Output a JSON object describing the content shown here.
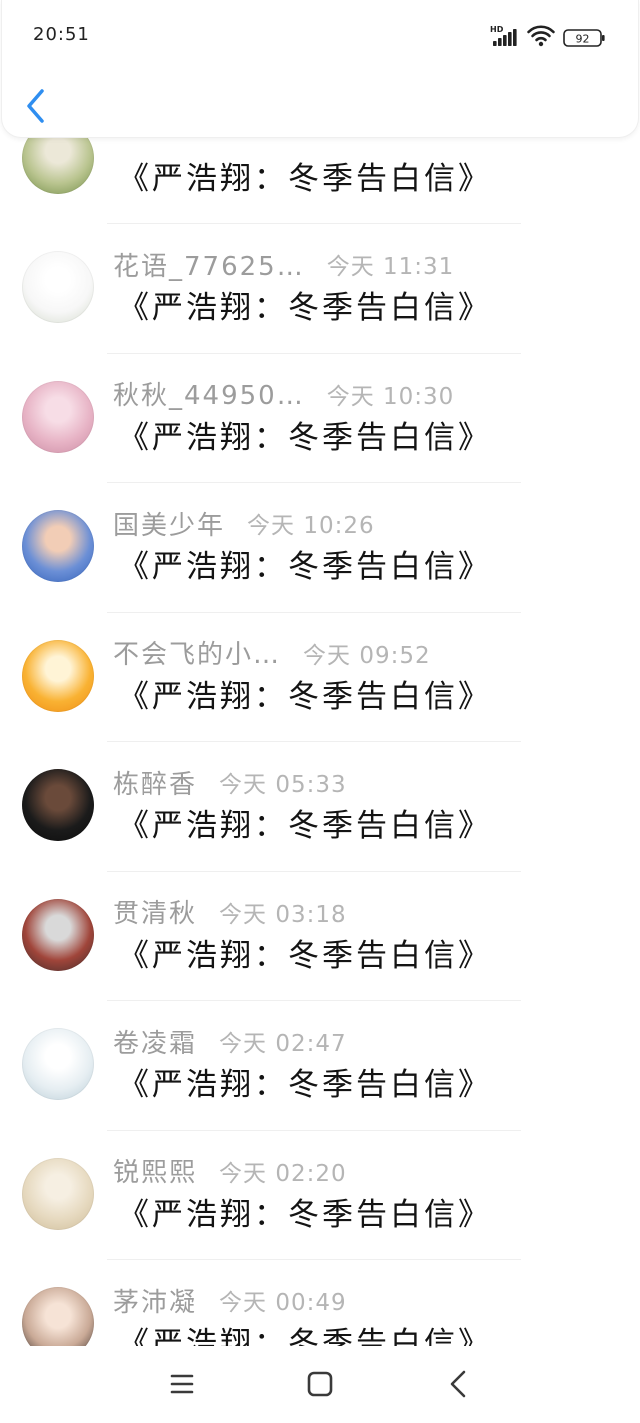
{
  "status_bar": {
    "time": "20:51",
    "network_badge": "HD",
    "battery_level": "92",
    "icons": [
      "signal-icon",
      "wifi-icon",
      "battery-icon"
    ]
  },
  "header": {
    "back_icon": "chevron-left-icon",
    "accent_color": "#2f8ef0"
  },
  "messages": [
    {
      "name": "",
      "time": "",
      "text": "《严浩翔：冬季告白信》",
      "avatar_colors": [
        "#ece8d8",
        "#b9c48f",
        "#6e8a43"
      ]
    },
    {
      "name": "花语_77625…",
      "time": "今天 11:31",
      "text": "《严浩翔：冬季告白信》",
      "avatar_colors": [
        "#ffffff",
        "#f7f7f7",
        "#d3dacb"
      ]
    },
    {
      "name": "秋秋_44950…",
      "time": "今天 10:30",
      "text": "《严浩翔：冬季告白信》",
      "avatar_colors": [
        "#f7dde6",
        "#e7b3c5",
        "#c98aa2"
      ]
    },
    {
      "name": "国美少年",
      "time": "今天 10:26",
      "text": "《严浩翔：冬季告白信》",
      "avatar_colors": [
        "#f2cdb6",
        "#6b8fd6",
        "#2f5fb8"
      ]
    },
    {
      "name": "不会飞的小…",
      "time": "今天 09:52",
      "text": "《严浩翔：冬季告白信》",
      "avatar_colors": [
        "#fff4d6",
        "#f9b233",
        "#ee8a12"
      ]
    },
    {
      "name": "栋醉香",
      "time": "今天 05:33",
      "text": "《严浩翔：冬季告白信》",
      "avatar_colors": [
        "#6a4a3a",
        "#1b1b1b",
        "#0a0a0a"
      ]
    },
    {
      "name": "贯清秋",
      "time": "今天 03:18",
      "text": "《严浩翔：冬季告白信》",
      "avatar_colors": [
        "#d9d9d9",
        "#a0453a",
        "#3a2a2a"
      ]
    },
    {
      "name": "卷凌霜",
      "time": "今天 02:47",
      "text": "《严浩翔：冬季告白信》",
      "avatar_colors": [
        "#ffffff",
        "#e6eef2",
        "#b8ccd6"
      ]
    },
    {
      "name": "锐熙熙",
      "time": "今天 02:20",
      "text": "《严浩翔：冬季告白信》",
      "avatar_colors": [
        "#f6efe2",
        "#e6d9bf",
        "#cdbb97"
      ]
    },
    {
      "name": "茅沛凝",
      "time": "今天 00:49",
      "text": "《严浩翔：冬季告白信》",
      "avatar_colors": [
        "#f6e3d6",
        "#c9a996",
        "#2e2522"
      ]
    }
  ],
  "nav_bar": {
    "icons": [
      "menu-icon",
      "home-square-icon",
      "back-icon"
    ]
  },
  "colors": {
    "name": "#9c9c9c",
    "time": "#b5b5b5",
    "message": "#141414",
    "separator": "#efefef",
    "icon": "#3a3a3a"
  }
}
